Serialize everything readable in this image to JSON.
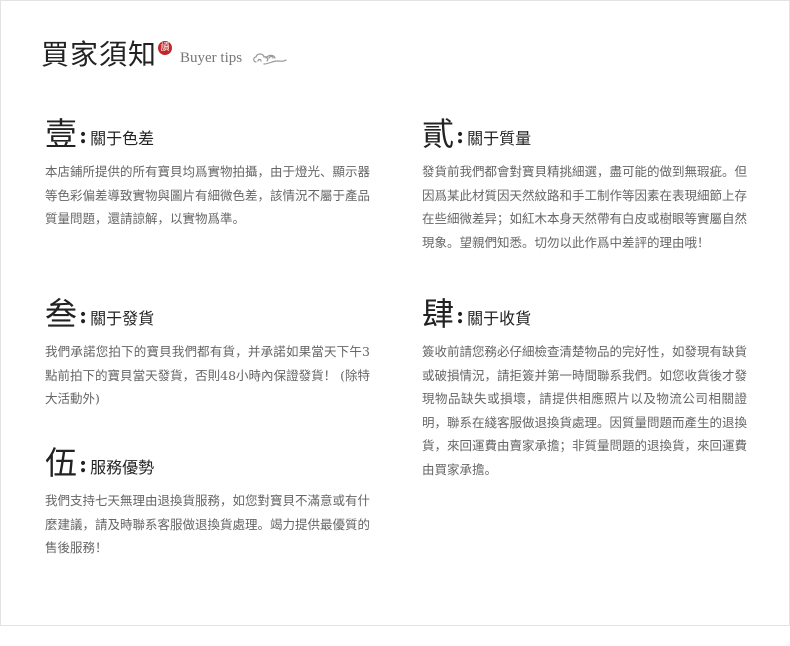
{
  "header": {
    "title_cn": "買家須知",
    "seal_char": "讀",
    "title_en": "Buyer tips"
  },
  "sections": [
    {
      "numeral": "壹",
      "colon": ":",
      "title": "關于色差",
      "body": "本店鋪所提供的所有寶貝均爲實物拍攝，由于燈光、顯示器等色彩偏差導致實物與圖片有細微色差，該情況不屬于產品質量問題，還請諒解，以實物爲準。"
    },
    {
      "numeral": "貳",
      "colon": ":",
      "title": "關于質量",
      "body": "發貨前我們都會對寶貝精挑細選，盡可能的做到無瑕疵。但因爲某此材質因天然紋路和手工制作等因素在表現細節上存在些細微差异；如紅木本身天然帶有白皮或樹眼等實屬自然現象。望親們知悉。切勿以此作爲中差評的理由哦！"
    },
    {
      "numeral": "叁",
      "colon": ":",
      "title": "關于發貨",
      "body": "我們承諾您拍下的寶貝我們都有貨，并承諾如果當天下午3點前拍下的寶貝當天發貨，否則48小時內保證發貨！ (除特大活動外)"
    },
    {
      "numeral": "肆",
      "colon": ":",
      "title": "關于收貨",
      "body": "簽收前請您務必仔細檢查清楚物品的完好性，如發現有缺貨或破損情況，請拒簽并第一時間聯系我們。如您收貨後才發現物品缺失或損壞，請提供相應照片以及物流公司相關證明，聯系在綫客服做退換貨處理。因質量問題而產生的退換貨，來回運費由賣家承擔；非質量問題的退換貨，來回運費由買家承擔。"
    },
    {
      "numeral": "伍",
      "colon": ":",
      "title": "服務優勢",
      "body": "我們支持七天無理由退換貨服務，如您對寶貝不滿意或有什麼建議，請及時聯系客服做退換貨處理。竭力提供最優質的售後服務！"
    }
  ],
  "colors": {
    "heading": "#222222",
    "body_text": "#666666",
    "seal": "#c0282c",
    "border": "#e3e3e3"
  },
  "icons": {
    "seal": "red-seal-icon",
    "cloud": "auspicious-cloud-icon"
  }
}
